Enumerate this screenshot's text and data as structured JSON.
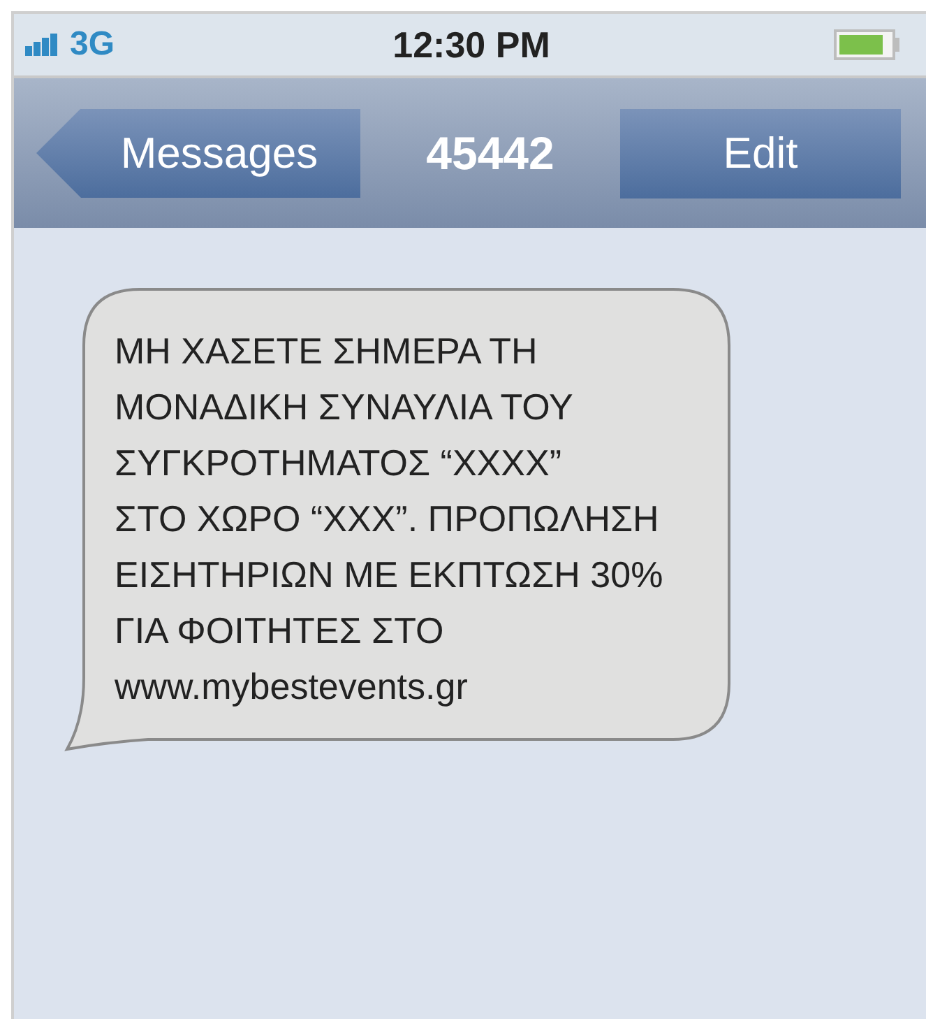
{
  "status_bar": {
    "network": "3G",
    "time": "12:30 PM"
  },
  "nav_bar": {
    "back_button": "Messages",
    "title": "45442",
    "edit_button": "Edit"
  },
  "messages": [
    {
      "kind": "received",
      "lines": [
        "ΜΗ ΧΑΣΕΤΕ ΣΗΜΕΡΑ ΤΗ",
        "ΜΟΝΑΔΙΚΗ ΣΥΝΑΥΛΙΑ ΤΟΥ",
        "ΣΥΓΚΡΟΤΗΜΑΤΟΣ “XXXX”",
        "ΣΤΟ ΧΩΡΟ “XXX”. ΠΡΟΠΩΛΗΣΗ",
        "ΕΙΣΗΤΗΡΙΩΝ ΜΕ ΕΚΠΤΩΣΗ 30%",
        "ΓΙΑ ΦΟΙΤΗΤΕΣ ΣΤΟ",
        "www.mybestevents.gr"
      ]
    }
  ]
}
